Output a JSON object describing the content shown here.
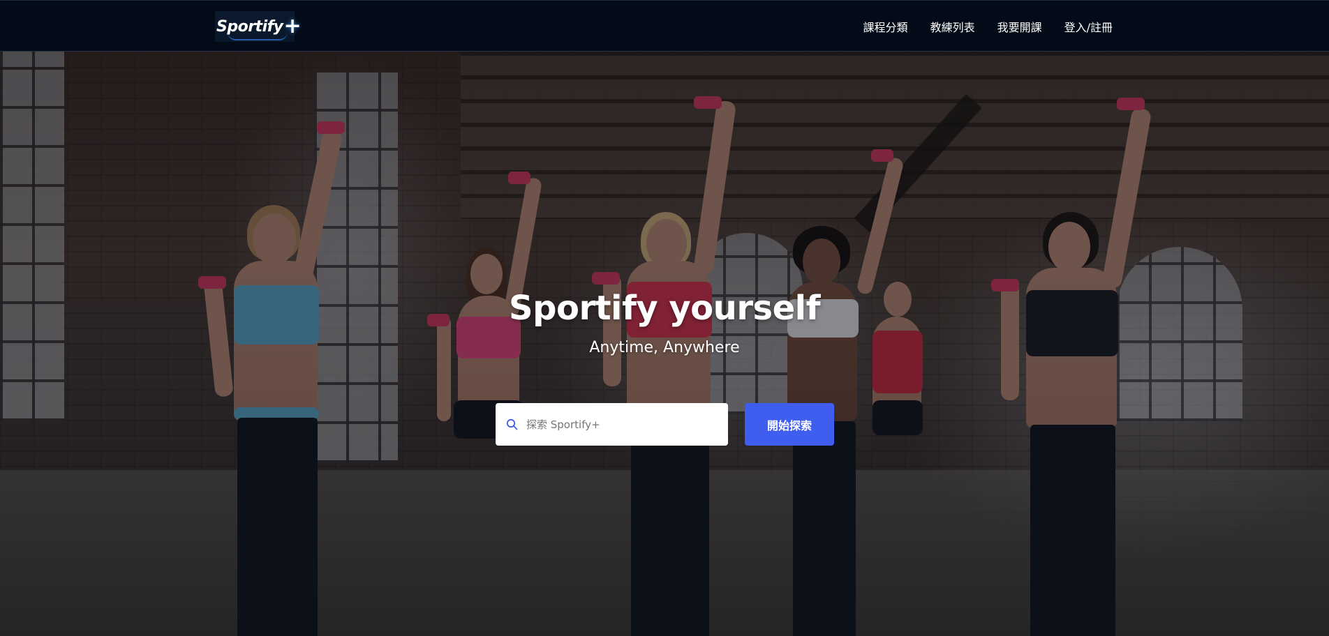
{
  "navbar": {
    "logo_text": "Sportify",
    "logo_plus": "+",
    "links": [
      {
        "label": "課程分類"
      },
      {
        "label": "教練列表"
      },
      {
        "label": "我要開課"
      },
      {
        "label": "登入/註冊"
      }
    ]
  },
  "hero": {
    "title": "Sportify yourself",
    "subtitle": "Anytime, Anywhere",
    "search": {
      "placeholder": "探索 Sportify+",
      "value": ""
    },
    "search_button_label": "開始探索"
  },
  "colors": {
    "navbar_bg": "#030b18",
    "accent_button": "#3f5ef0",
    "search_icon": "#3f5ef0"
  },
  "icons": {
    "search": "search-icon"
  }
}
